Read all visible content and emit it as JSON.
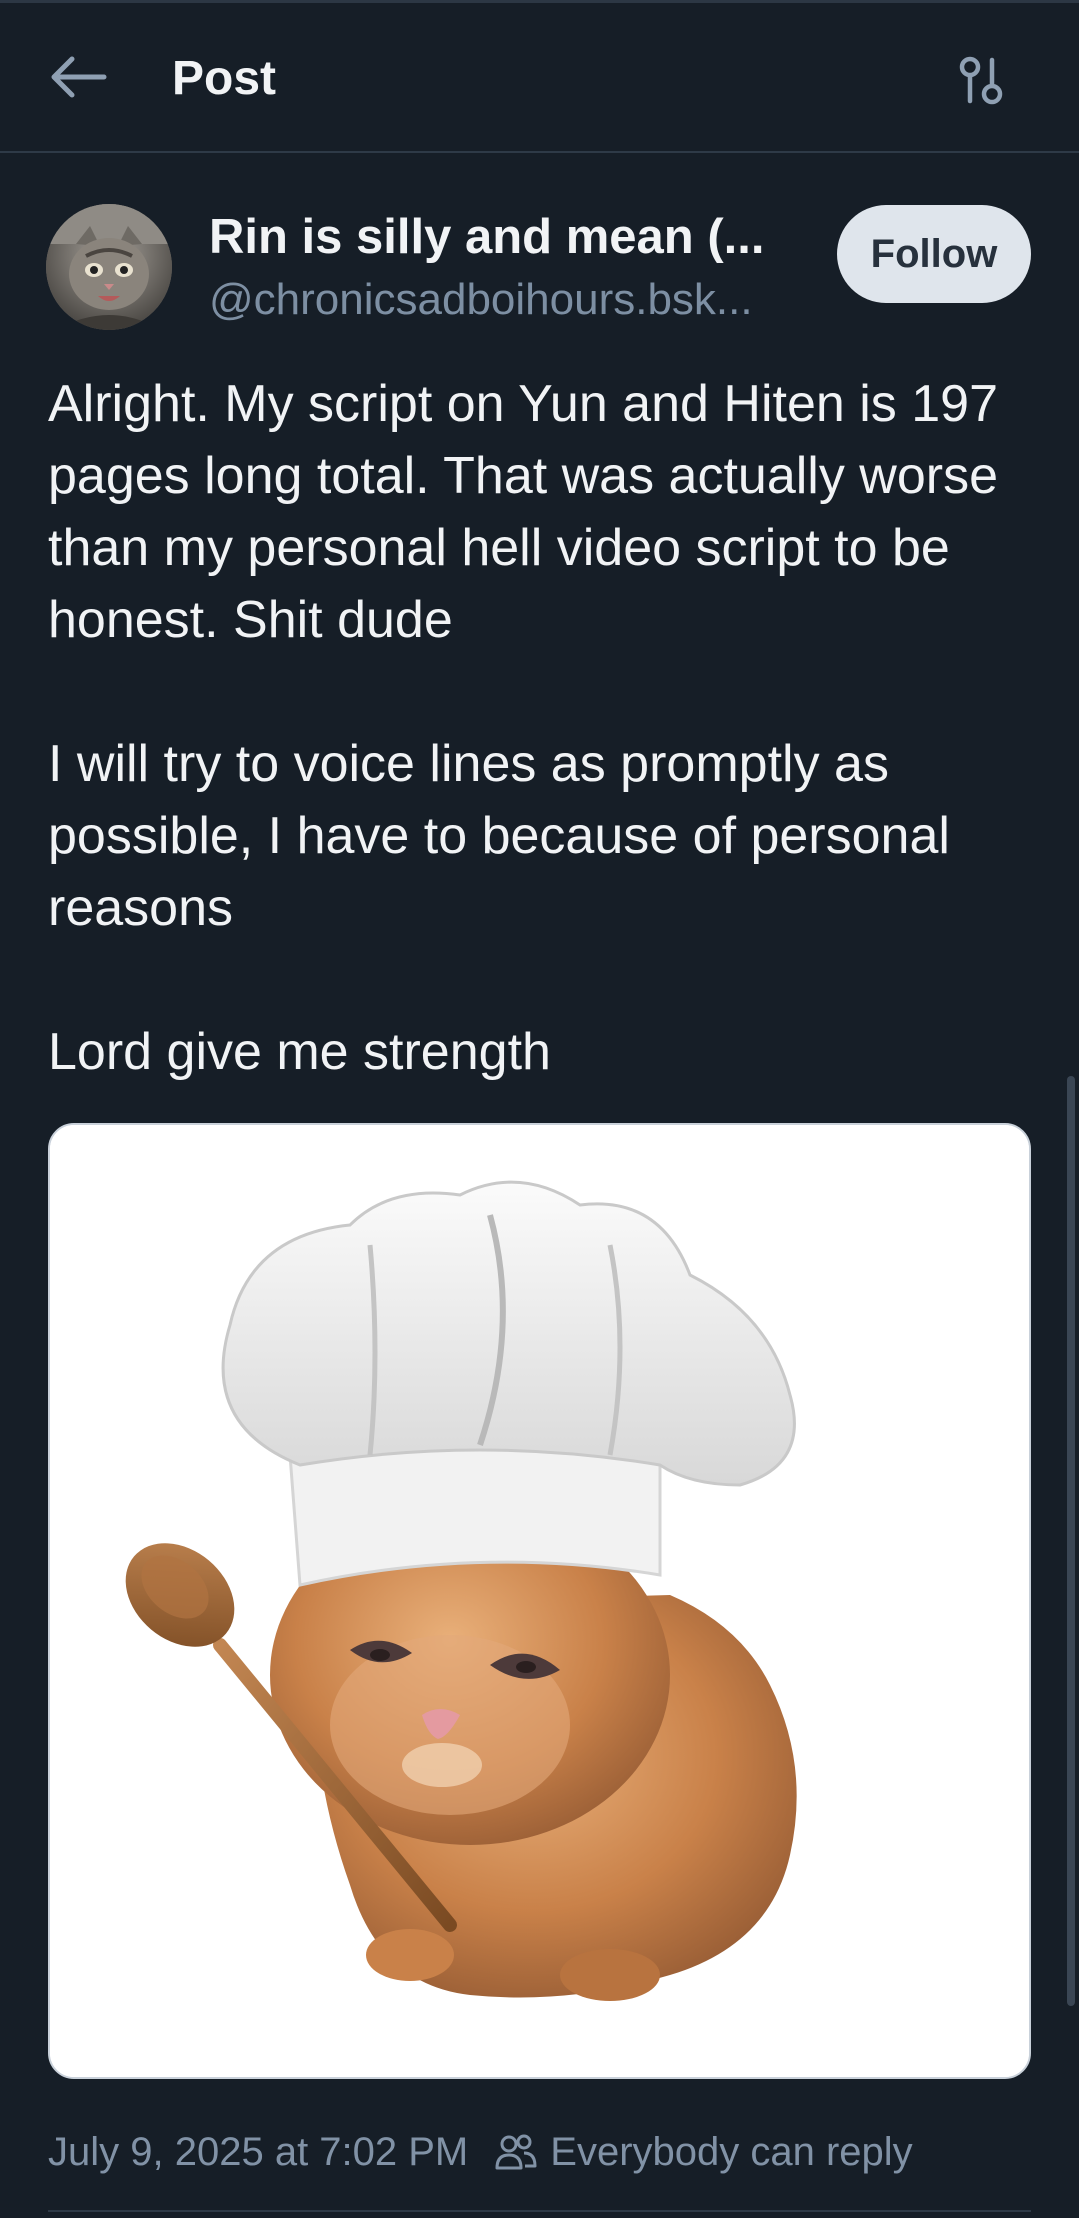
{
  "header": {
    "title": "Post",
    "back_icon": "arrow-left-icon",
    "filter_icon": "sliders-icon"
  },
  "author": {
    "display_name": "Rin is silly and mean (...",
    "handle": "@chronicsadboihours.bsk...",
    "follow_label": "Follow",
    "avatar_icon": "cat-avatar"
  },
  "post": {
    "paragraphs": [
      "Alright. My script on Yun and Hiten is 197 pages long total. That was actually worse than my personal hell video script to be honest. Shit dude",
      "I will try to voice lines as promptly as possible, I have to because of personal reasons",
      "Lord give me strength"
    ],
    "image_icon": "chef-cat-image"
  },
  "meta": {
    "timestamp": "July 9, 2025 at 7:02 PM",
    "reply_setting": "Everybody can reply",
    "reply_icon": "people-icon"
  },
  "colors": {
    "background": "#161e27",
    "text": "#f1f3f5",
    "muted": "#7d8fa3",
    "follow_bg": "#dfe5ec",
    "divider": "#2e3a47"
  }
}
